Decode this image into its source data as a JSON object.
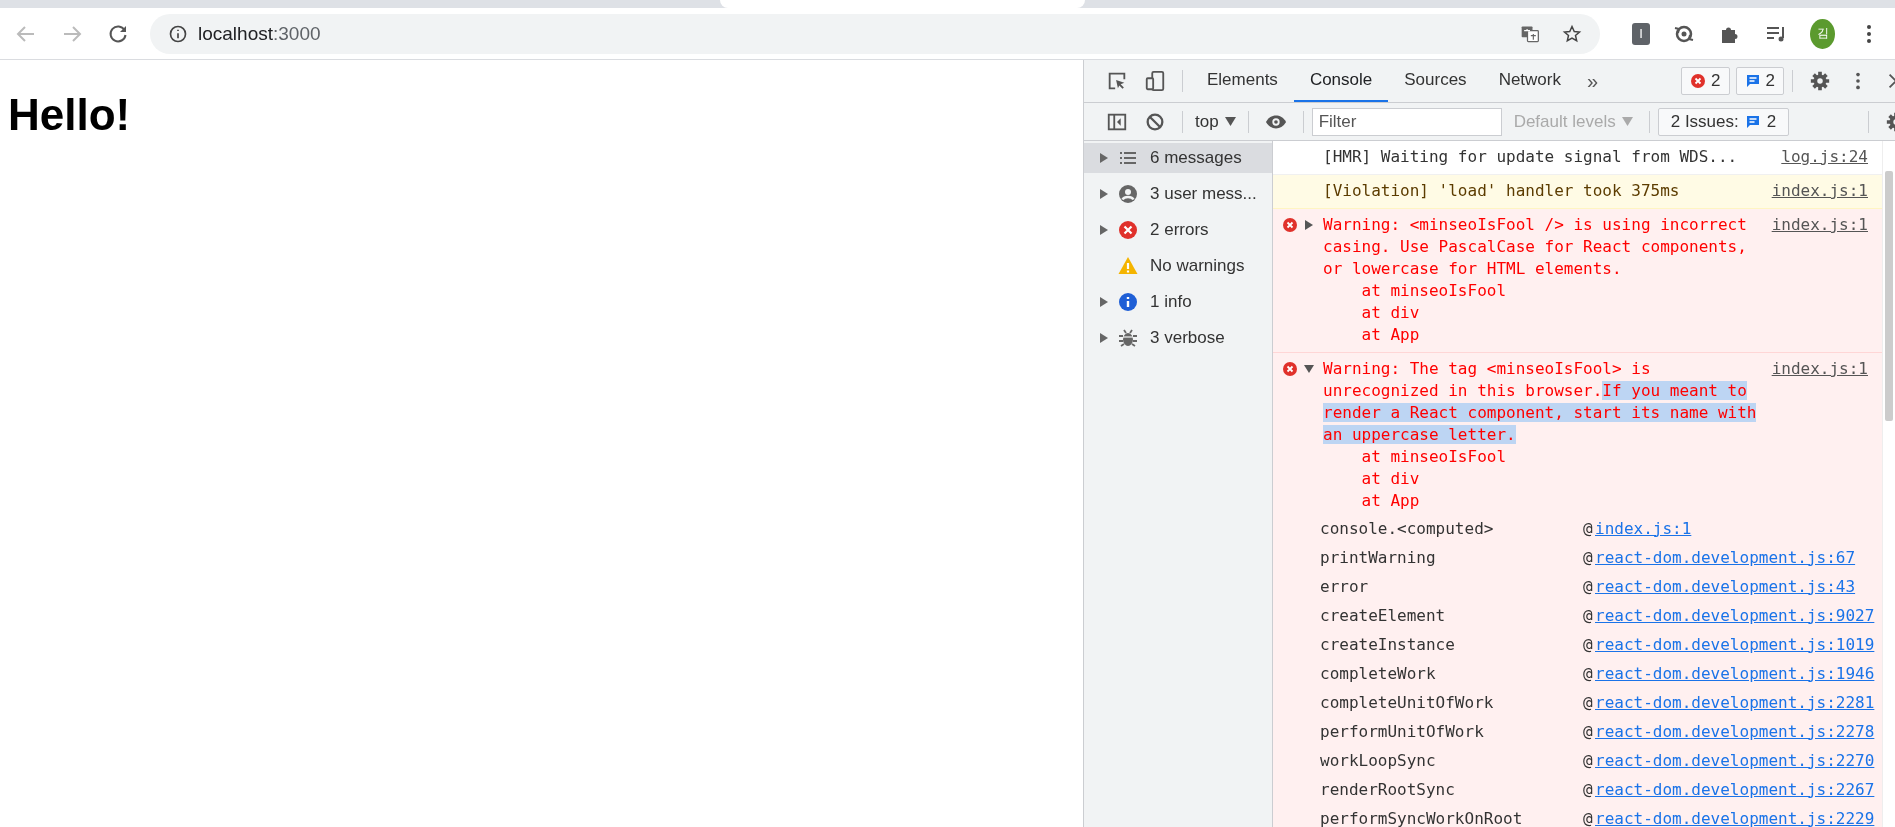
{
  "browser": {
    "url_host": "localhost",
    "url_port": ":3000",
    "extension_label": "I",
    "avatar": "김"
  },
  "page": {
    "heading": "Hello!"
  },
  "devtools": {
    "tabs": [
      {
        "label": "Elements",
        "selected": false
      },
      {
        "label": "Console",
        "selected": true
      },
      {
        "label": "Sources",
        "selected": false
      },
      {
        "label": "Network",
        "selected": false
      }
    ],
    "overflow": "»",
    "error_count": "2",
    "message_count": "2",
    "console_toolbar": {
      "context": "top",
      "filter_placeholder": "Filter",
      "levels": "Default levels",
      "issues_label": "2 Issues:",
      "issues_count": "2"
    },
    "sidebar": [
      {
        "kind": "all",
        "label": "6 messages",
        "selected": true,
        "expandable": true
      },
      {
        "kind": "user",
        "label": "3 user mess...",
        "selected": false,
        "expandable": true
      },
      {
        "kind": "error",
        "label": "2 errors",
        "selected": false,
        "expandable": true
      },
      {
        "kind": "warning",
        "label": "No warnings",
        "selected": false,
        "expandable": false
      },
      {
        "kind": "info",
        "label": "1 info",
        "selected": false,
        "expandable": true
      },
      {
        "kind": "verbose",
        "label": "3 verbose",
        "selected": false,
        "expandable": true
      }
    ],
    "messages": [
      {
        "kind": "log",
        "text": "[HMR] Waiting for update signal from WDS...",
        "source": "log.js:24"
      },
      {
        "kind": "violation",
        "text": "[Violation] 'load' handler took 375ms",
        "source": "index.js:1"
      },
      {
        "kind": "error",
        "expanded": false,
        "text": "Warning: <minseoIsFool /> is using incorrect casing. Use PascalCase for React components, or lowercase for HTML elements.",
        "source": "index.js:1",
        "stack": [
          "at minseoIsFool",
          "at div",
          "at App"
        ]
      },
      {
        "kind": "error",
        "expanded": true,
        "text": "Warning: The tag <minseoIsFool> is unrecognized in this browser.",
        "selected_text": "If you meant to render a React component, start its name with an uppercase letter.",
        "source": "index.js:1",
        "stack": [
          "at minseoIsFool",
          "at div",
          "at App"
        ],
        "call_stack": [
          {
            "function": "console.<computed>",
            "at": "@",
            "location": "index.js:1"
          },
          {
            "function": "printWarning",
            "at": "@",
            "location": "react-dom.development.js:67"
          },
          {
            "function": "error",
            "at": "@",
            "location": "react-dom.development.js:43"
          },
          {
            "function": "createElement",
            "at": "@",
            "location": "react-dom.development.js:9027"
          },
          {
            "function": "createInstance",
            "at": "@",
            "location": "react-dom.development.js:1019"
          },
          {
            "function": "completeWork",
            "at": "@",
            "location": "react-dom.development.js:1946"
          },
          {
            "function": "completeUnitOfWork",
            "at": "@",
            "location": "react-dom.development.js:2281"
          },
          {
            "function": "performUnitOfWork",
            "at": "@",
            "location": "react-dom.development.js:2278"
          },
          {
            "function": "workLoopSync",
            "at": "@",
            "location": "react-dom.development.js:2270"
          },
          {
            "function": "renderRootSync",
            "at": "@",
            "location": "react-dom.development.js:2267"
          },
          {
            "function": "performSyncWorkOnRoot",
            "at": "@",
            "location": "react-dom.development.js:2229"
          }
        ]
      }
    ]
  }
}
